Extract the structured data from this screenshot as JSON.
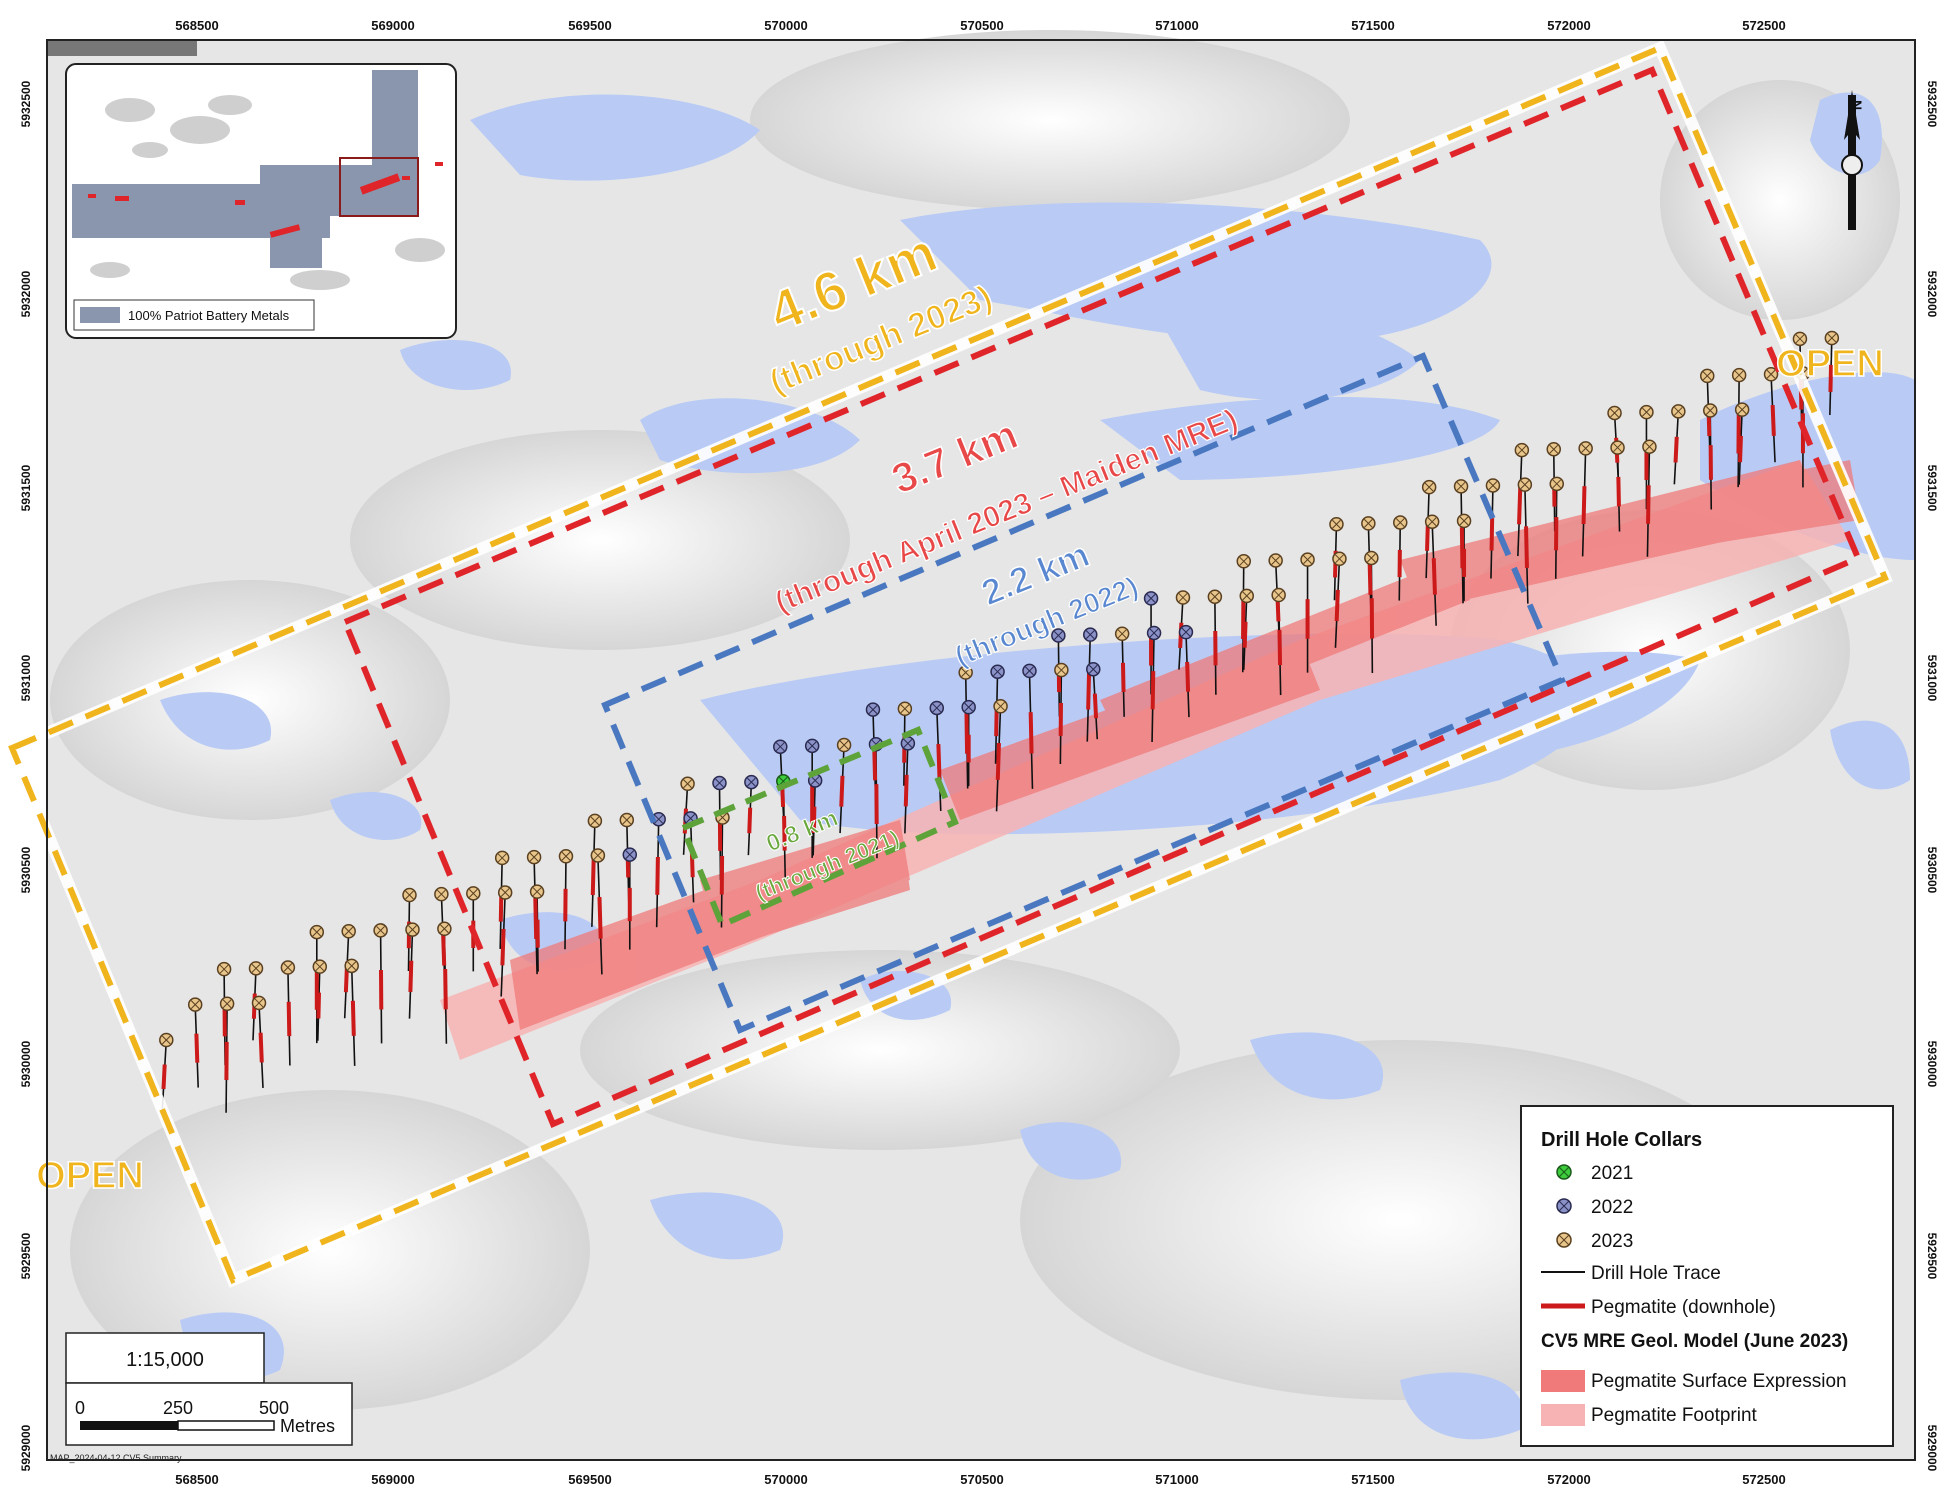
{
  "map": {
    "x_ticks": [
      "568500",
      "569000",
      "569500",
      "570000",
      "570500",
      "571000",
      "571500",
      "572000",
      "572500"
    ],
    "y_ticks": [
      "5932500",
      "5932000",
      "5931500",
      "5931000",
      "5930500",
      "5930000",
      "5929500",
      "5929000"
    ],
    "footer_note": "MAP_2024-04-12 CV5 Summary"
  },
  "annotations": {
    "km_46": "4.6 km",
    "through_2023": "(through 2023)",
    "km_37": "3.7 km",
    "through_april": "(through April 2023 – Maiden MRE)",
    "km_22": "2.2 km",
    "through_2022": "(through 2022)",
    "km_08": "0.8 km",
    "through_2021": "(through 2021)",
    "open_left": "OPEN",
    "open_right": "OPEN"
  },
  "inset": {
    "legend_label": "100% Patriot Battery Metals"
  },
  "scale": {
    "ratio": "1:15,000",
    "label_0": "0",
    "label_250": "250",
    "label_500": "500",
    "unit": "Metres"
  },
  "legend": {
    "title": "Drill Hole Collars",
    "collar_2021": "2021",
    "collar_2022": "2022",
    "collar_2023": "2023",
    "trace": "Drill Hole Trace",
    "pegmatite_downhole": "Pegmatite (downhole)",
    "model_title": "CV5 MRE Geol. Model (June 2023)",
    "surface_expression": "Pegmatite Surface Expression",
    "footprint": "Pegmatite Footprint"
  },
  "colors": {
    "open_yellow": "#f0b41c",
    "mre_red": "#e0252a",
    "blue_2022": "#4a78c0",
    "green_2021": "#5ea33a",
    "water": "#b9cbf5",
    "pegmatite_surface": "#f07a7a",
    "pegmatite_footprint": "#f7b3b3",
    "collar_2021": "#3ccc3c",
    "collar_2022": "#8a92c8",
    "collar_2023": "#e8c58a"
  }
}
